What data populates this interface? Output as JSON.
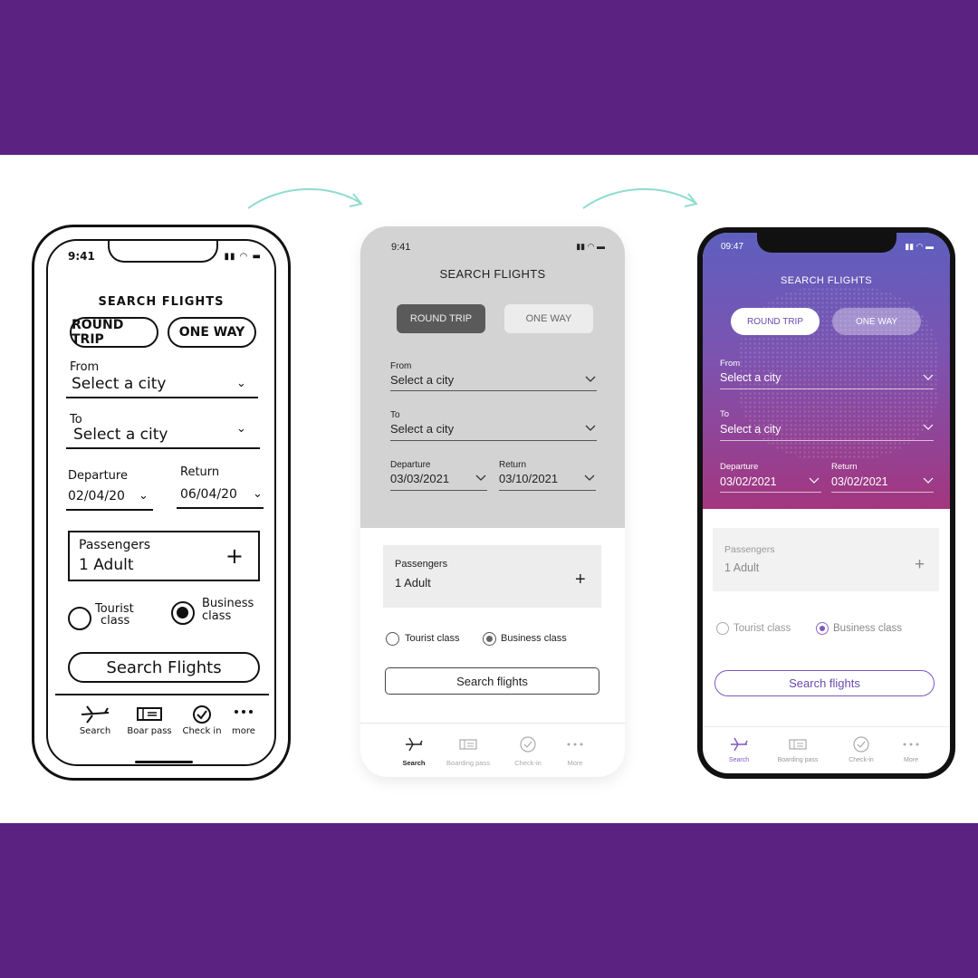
{
  "colors": {
    "background": "#5b2282",
    "accent": "#7e57c2",
    "arrow": "#8fdcd0"
  },
  "sketch": {
    "time": "9:41",
    "title": "SEARCH FLIGHTS",
    "round_trip": "ROUND TRIP",
    "one_way": "ONE WAY",
    "from_label": "From",
    "from_value": "Select a city",
    "to_label": "To",
    "to_value": "Select a city",
    "departure_label": "Departure",
    "departure_value": "02/04/20",
    "return_label": "Return",
    "return_value": "06/04/20",
    "passengers_label": "Passengers",
    "passengers_value": "1 Adult",
    "tourist_label_1": "Tourist",
    "tourist_label_2": "class",
    "business_label_1": "Business",
    "business_label_2": "class",
    "search_button": "Search Flights",
    "nav": {
      "search": "Search",
      "boarding": "Boar pass",
      "checkin": "Check in",
      "more": "more"
    }
  },
  "wireframe": {
    "time": "9:41",
    "title": "SEARCH FLIGHTS",
    "round_trip": "ROUND TRIP",
    "one_way": "ONE WAY",
    "from_label": "From",
    "from_value": "Select a city",
    "to_label": "To",
    "to_value": "Select a city",
    "departure_label": "Departure",
    "departure_value": "03/03/2021",
    "return_label": "Return",
    "return_value": "03/10/2021",
    "passengers_label": "Passengers",
    "passengers_value": "1 Adult",
    "tourist_label": "Tourist class",
    "business_label": "Business class",
    "search_button": "Search flights",
    "nav": {
      "search": "Search",
      "boarding": "Boarding pass",
      "checkin": "Check-in",
      "more": "More"
    }
  },
  "final": {
    "time": "09:47",
    "title": "SEARCH FLIGHTS",
    "round_trip": "ROUND TRIP",
    "one_way": "ONE WAY",
    "from_label": "From",
    "from_value": "Select a city",
    "to_label": "To",
    "to_value": "Select a city",
    "departure_label": "Departure",
    "departure_value": "03/02/2021",
    "return_label": "Return",
    "return_value": "03/02/2021",
    "passengers_label": "Passengers",
    "passengers_value": "1 Adult",
    "tourist_label": "Tourist class",
    "business_label": "Business class",
    "search_button": "Search flights",
    "nav": {
      "search": "Search",
      "boarding": "Boarding pass",
      "checkin": "Check-in",
      "more": "More"
    }
  }
}
